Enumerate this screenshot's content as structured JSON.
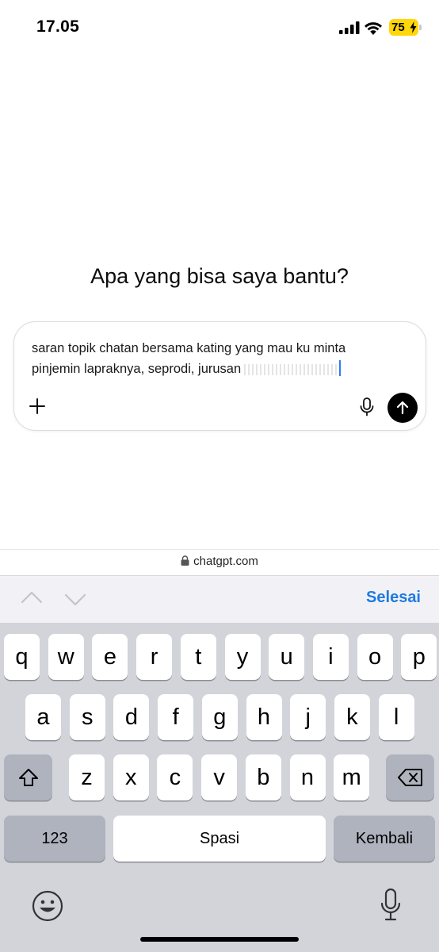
{
  "status_bar": {
    "time": "17.05",
    "battery": "75"
  },
  "main": {
    "headline": "Apa yang bisa saya bantu?",
    "composer": {
      "line1": "saran topik chatan bersama kating yang mau ku minta",
      "line2": "pinjemin lapraknya, seprodi, jurusan"
    }
  },
  "url_bar": {
    "domain": "chatgpt.com"
  },
  "keyboard_toolbar": {
    "done_label": "Selesai"
  },
  "keyboard": {
    "row1": [
      "q",
      "w",
      "e",
      "r",
      "t",
      "y",
      "u",
      "i",
      "o",
      "p"
    ],
    "row2": [
      "a",
      "s",
      "d",
      "f",
      "g",
      "h",
      "j",
      "k",
      "l"
    ],
    "row3": [
      "z",
      "x",
      "c",
      "v",
      "b",
      "n",
      "m"
    ],
    "numbers_label": "123",
    "space_label": "Spasi",
    "return_label": "Kembali"
  },
  "icons": {
    "signal": "cellular-signal-icon",
    "wifi": "wifi-icon",
    "lock": "lock-icon",
    "plus": "plus-icon",
    "mic": "microphone-icon",
    "send": "arrow-up-icon",
    "shift": "shift-icon",
    "delete": "backspace-icon",
    "emoji": "emoji-icon",
    "dictation": "microphone-icon"
  },
  "colors": {
    "accent": "#1f7ae0",
    "battery": "#ffd60a",
    "keyboard_bg": "#d2d4da",
    "dark_key": "#aeb3be"
  }
}
